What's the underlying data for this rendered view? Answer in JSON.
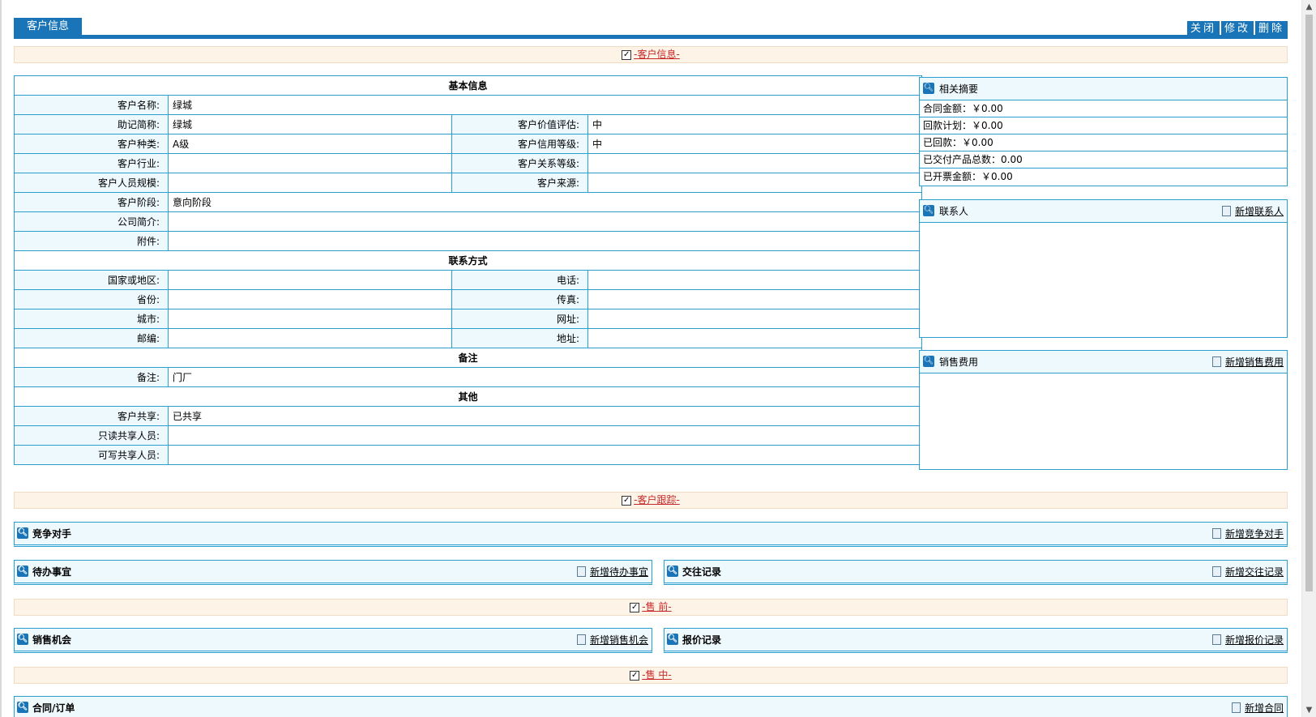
{
  "header": {
    "tab_label": "客户信息",
    "actions": [
      "关闭",
      "修改",
      "删除"
    ]
  },
  "sections": {
    "customer_info": "-客户信息-",
    "customer_track": "-客户跟踪-",
    "presale": "-售 前-",
    "insale": "-售 中-"
  },
  "info": {
    "basic_header": "基本信息",
    "name_label": "客户名称:",
    "name_value": "绿城",
    "abbr_label": "助记简称:",
    "abbr_value": "绿城",
    "value_eval_label": "客户价值评估:",
    "value_eval_value": "中",
    "kind_label": "客户种类:",
    "kind_value": "A级",
    "credit_label": "客户信用等级:",
    "credit_value": "中",
    "industry_label": "客户行业:",
    "industry_value": "",
    "relation_label": "客户关系等级:",
    "relation_value": "",
    "size_label": "客户人员规模:",
    "size_value": "",
    "source_label": "客户来源:",
    "source_value": "",
    "stage_label": "客户阶段:",
    "stage_value": "意向阶段",
    "intro_label": "公司简介:",
    "intro_value": "",
    "attach_label": "附件:",
    "attach_value": "",
    "contact_header": "联系方式",
    "country_label": "国家或地区:",
    "country_value": "",
    "phone_label": "电话:",
    "phone_value": "",
    "province_label": "省份:",
    "province_value": "",
    "fax_label": "传真:",
    "fax_value": "",
    "city_label": "城市:",
    "city_value": "",
    "web_label": "网址:",
    "web_value": "",
    "zip_label": "邮编:",
    "zip_value": "",
    "addr_label": "地址:",
    "addr_value": "",
    "remark_header": "备注",
    "remark_label": "备注:",
    "remark_value": "门厂",
    "other_header": "其他",
    "share_label": "客户共享:",
    "share_value": "已共享",
    "readonly_label": "只读共享人员:",
    "readonly_value": "",
    "writable_label": "可写共享人员:",
    "writable_value": ""
  },
  "summary": {
    "title": "相关摘要",
    "rows": [
      "合同金额：￥0.00",
      "回款计划：￥0.00",
      "已回款：￥0.00",
      "已交付产品总数：0.00",
      "已开票金额：￥0.00"
    ]
  },
  "contacts": {
    "title": "联系人",
    "add": "新增联系人"
  },
  "sales_cost": {
    "title": "销售费用",
    "add": "新增销售费用"
  },
  "modules": {
    "competitor": {
      "title": "竞争对手",
      "add": "新增竞争对手"
    },
    "todo": {
      "title": "待办事宜",
      "add": "新增待办事宜"
    },
    "contact_log": {
      "title": "交往记录",
      "add": "新增交往记录"
    },
    "opportunity": {
      "title": "销售机会",
      "add": "新增销售机会"
    },
    "quote": {
      "title": "报价记录",
      "add": "新增报价记录"
    },
    "contract": {
      "title": "合同/订单",
      "add": "新增合同"
    }
  },
  "colors": {
    "accent": "#1a75b8",
    "border": "#2a9fd0",
    "label_bg": "#eef9fe",
    "section_bg": "#fdf3e6"
  }
}
